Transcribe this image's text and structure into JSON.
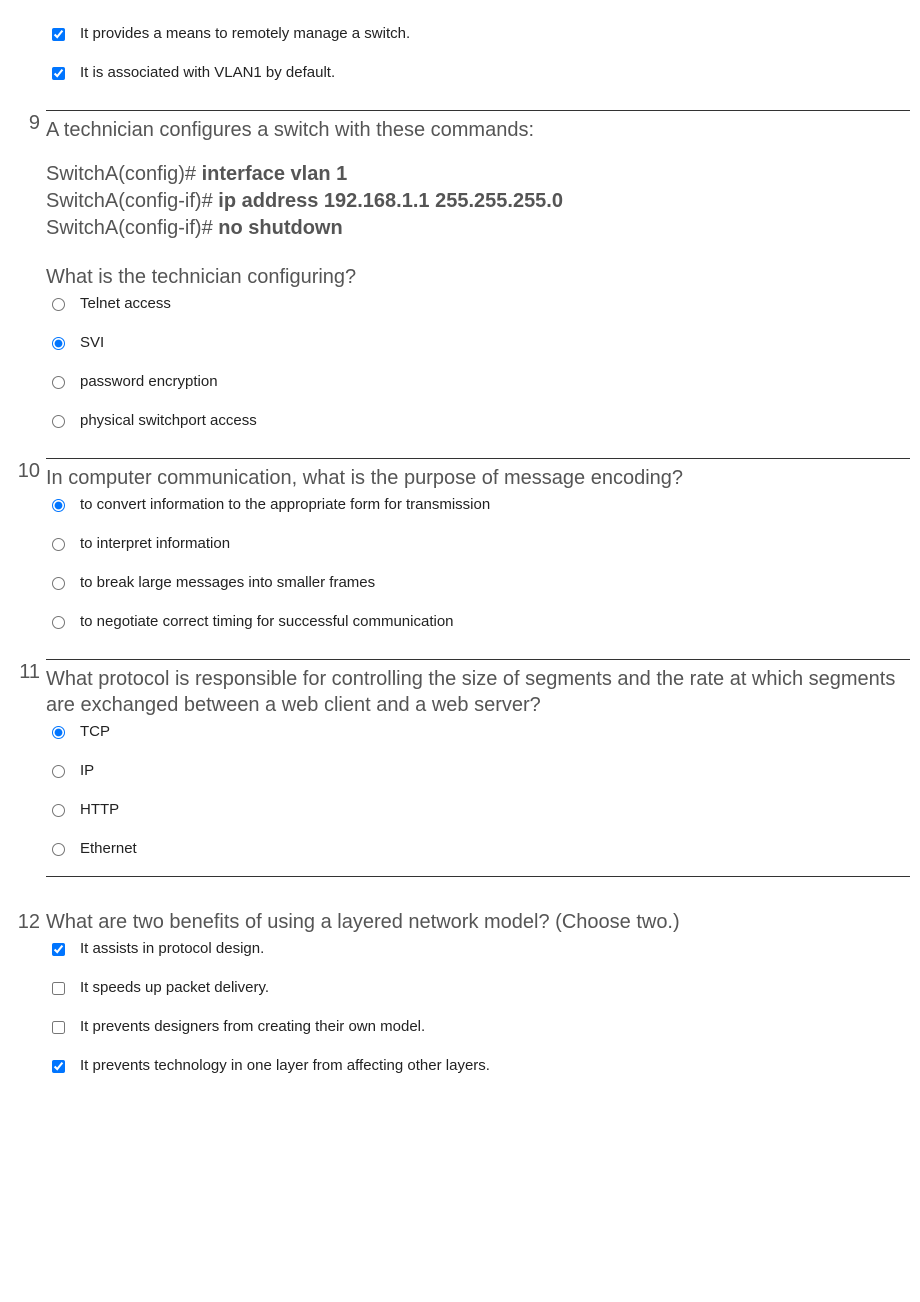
{
  "pre_options": [
    {
      "label": "It provides a means to remotely manage a switch.",
      "checked": true
    },
    {
      "label": "It is associated with VLAN1 by default.",
      "checked": true
    }
  ],
  "questions": [
    {
      "number": "9",
      "prompt_intro": "A technician configures a switch with these commands:",
      "code": [
        {
          "prefix": "SwitchA(config)# ",
          "bold": "interface vlan 1"
        },
        {
          "prefix": "SwitchA(config-if)# ",
          "bold": "ip address 192.168.1.1 255.255.255.0"
        },
        {
          "prefix": "SwitchA(config-if)# ",
          "bold": "no shutdown"
        }
      ],
      "prompt_followup": "What is the technician configuring?",
      "type": "radio",
      "options": [
        {
          "label": "Telnet access",
          "checked": false
        },
        {
          "label": "SVI",
          "checked": true
        },
        {
          "label": "password encryption",
          "checked": false
        },
        {
          "label": "physical switchport access",
          "checked": false
        }
      ]
    },
    {
      "number": "10",
      "prompt": "In computer communication, what is the purpose of message encoding?",
      "type": "radio",
      "options": [
        {
          "label": "to convert information to the appropriate form for transmission",
          "checked": true
        },
        {
          "label": "to interpret information",
          "checked": false
        },
        {
          "label": "to break large messages into smaller frames",
          "checked": false
        },
        {
          "label": "to negotiate correct timing for successful communication",
          "checked": false
        }
      ]
    },
    {
      "number": "11",
      "prompt": "What protocol is responsible for controlling the size of segments and the rate at which segments are exchanged between a web client and a web server?",
      "type": "radio",
      "options": [
        {
          "label": "TCP",
          "checked": true
        },
        {
          "label": "IP",
          "checked": false
        },
        {
          "label": "HTTP",
          "checked": false
        },
        {
          "label": "Ethernet",
          "checked": false
        }
      ]
    },
    {
      "number": "12",
      "prompt": "What are two benefits of using a layered network model? (Choose two.)",
      "type": "checkbox",
      "options": [
        {
          "label": "It assists in protocol design.",
          "checked": true
        },
        {
          "label": "It speeds up packet delivery.",
          "checked": false
        },
        {
          "label": "It prevents designers from creating their own model.",
          "checked": false
        },
        {
          "label": "It prevents technology in one layer from affecting other layers.",
          "checked": true
        }
      ]
    }
  ]
}
